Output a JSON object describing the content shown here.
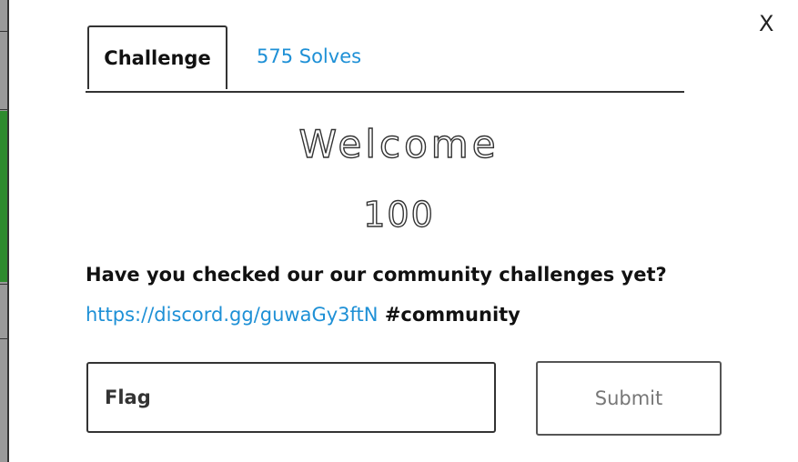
{
  "modal": {
    "close_label": "X",
    "tabs": {
      "challenge": "Challenge",
      "solves": "575 Solves"
    },
    "title": "Welcome",
    "points": "100",
    "description": "Have you checked our our community challenges yet?",
    "link": {
      "url_text": "https://discord.gg/guwaGy3ftN",
      "suffix": "#community"
    },
    "flag_input": {
      "placeholder": "Flag",
      "value": ""
    },
    "submit_label": "Submit"
  },
  "colors": {
    "link": "#1e90d6",
    "border": "#333333",
    "background_accent": "#2e8b2e"
  }
}
